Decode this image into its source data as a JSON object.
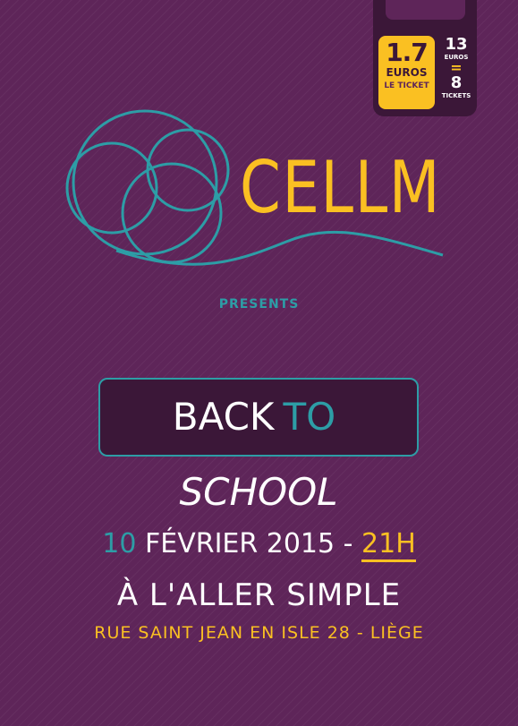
{
  "price": {
    "amount": "1.7",
    "currency": "EUROS",
    "per": "LE TICKET"
  },
  "deal": {
    "amount": "13",
    "currency": "EUROS",
    "equals": "=",
    "count": "8",
    "count_label": "TICKETS"
  },
  "brand": {
    "name": "CELLM",
    "presents": "PRESENTS"
  },
  "event": {
    "word_back": "BACK",
    "word_to": "TO",
    "word_school": "SCHOOL"
  },
  "date": {
    "day": "10",
    "month_year": "FÉVRIER 2015",
    "separator": "-",
    "time": "21H"
  },
  "venue": {
    "name": "À L'ALLER SIMPLE",
    "address": "RUE SAINT JEAN EN ISLE 28 - LIÈGE"
  },
  "colors": {
    "background": "#5e2559",
    "dark_panel": "#3b1738",
    "accent_yellow": "#fac022",
    "accent_teal": "#2d9da6",
    "text_white": "#ffffff"
  },
  "icons": {
    "logo": "cellm-circles-logo-icon"
  }
}
